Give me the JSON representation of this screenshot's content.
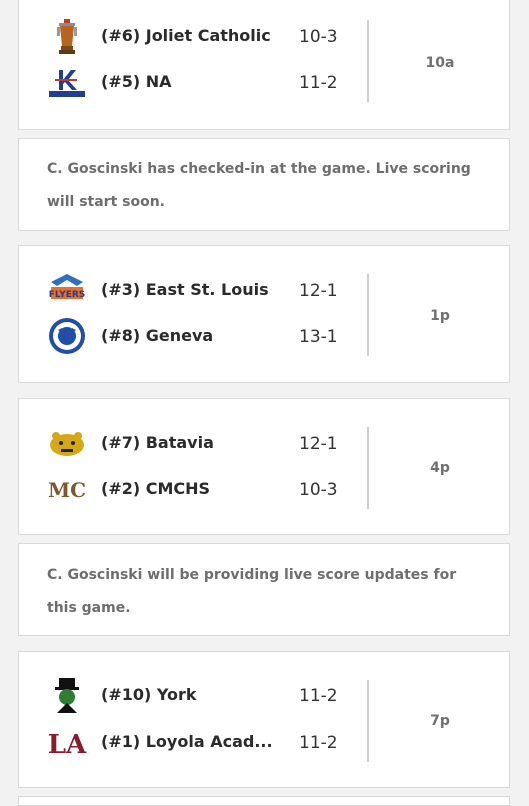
{
  "games": [
    {
      "time": "10a",
      "teams": [
        {
          "name": "(#6) Joliet Catholic",
          "record": "10-3",
          "logo": "trophy-icon"
        },
        {
          "name": "(#5) NA",
          "record": "11-2",
          "logo": "naperville-logo-icon"
        }
      ]
    },
    {
      "time": "1p",
      "teams": [
        {
          "name": "(#3) East St. Louis",
          "record": "12-1",
          "logo": "flyers-logo-icon"
        },
        {
          "name": "(#8) Geneva",
          "record": "13-1",
          "logo": "viking-logo-icon"
        }
      ]
    },
    {
      "time": "4p",
      "teams": [
        {
          "name": "(#7) Batavia",
          "record": "12-1",
          "logo": "bulldog-logo-icon"
        },
        {
          "name": "(#2) CMCHS",
          "record": "10-3",
          "logo": "mc-logo-icon"
        }
      ]
    },
    {
      "time": "7p",
      "teams": [
        {
          "name": "(#10) York",
          "record": "11-2",
          "logo": "duke-logo-icon"
        },
        {
          "name": "(#1) Loyola Acad...",
          "record": "11-2",
          "logo": "la-logo-icon"
        }
      ]
    }
  ],
  "messages": [
    "C. Goscinski has checked-in at the game. Live scoring will start soon.",
    "C. Goscinski will be providing live score updates for this game."
  ],
  "colors": {
    "background": "#f2f2f2",
    "card": "#ffffff",
    "border": "#d9d9d9",
    "team_text": "#2b2b2b",
    "time_text": "#707070",
    "message_text": "#6e6e6e"
  }
}
